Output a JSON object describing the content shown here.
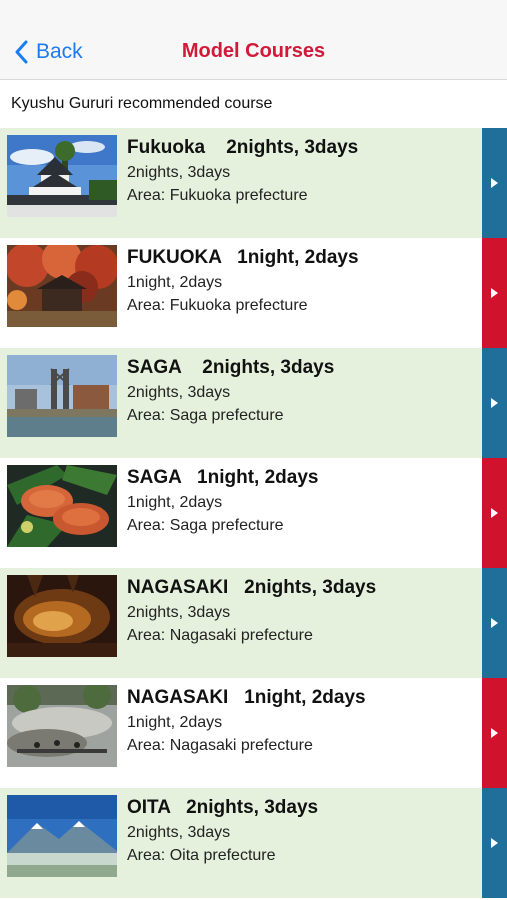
{
  "nav": {
    "back_label": "Back",
    "title": "Model Courses"
  },
  "subheader": "Kyushu Gururi recommended course",
  "courses": [
    {
      "title": "Fukuoka    2nights, 3days",
      "duration": "2nights, 3days",
      "area": "Area: Fukuoka prefecture",
      "bar": "blue",
      "photo": "castle"
    },
    {
      "title": "FUKUOKA   1night, 2days",
      "duration": "1night, 2days",
      "area": "Area: Fukuoka prefecture",
      "bar": "red",
      "photo": "autumn-temple"
    },
    {
      "title": "SAGA    2nights, 3days",
      "duration": "2nights, 3days",
      "area": "Area: Saga prefecture",
      "bar": "blue",
      "photo": "industrial-site"
    },
    {
      "title": "SAGA   1night, 2days",
      "duration": "1night, 2days",
      "area": "Area: Saga prefecture",
      "bar": "red",
      "photo": "crabs"
    },
    {
      "title": "NAGASAKI   2nights, 3days",
      "duration": "2nights, 3days",
      "area": "Area: Nagasaki prefecture",
      "bar": "blue",
      "photo": "cave"
    },
    {
      "title": "NAGASAKI   1night, 2days",
      "duration": "1night, 2days",
      "area": "Area: Nagasaki prefecture",
      "bar": "red",
      "photo": "hot-spring"
    },
    {
      "title": "OITA   2nights, 3days",
      "duration": "2nights, 3days",
      "area": "Area: Oita prefecture",
      "bar": "blue",
      "photo": "mountain"
    }
  ]
}
